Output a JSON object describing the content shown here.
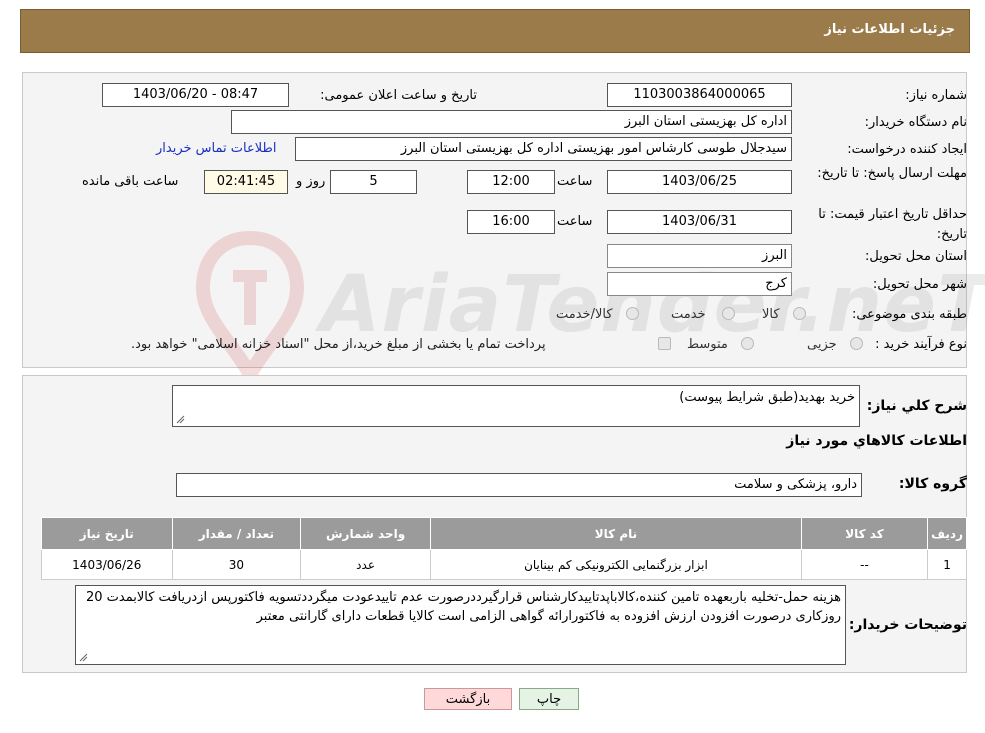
{
  "header": {
    "title": "جزئیات اطلاعات نیاز"
  },
  "details": {
    "need_number_label": "شماره نیاز:",
    "need_number": "1103003864000065",
    "announce_label": "تاریخ و ساعت اعلان عمومی:",
    "announce_value": "1403/06/20 - 08:47",
    "buyer_org_label": "نام دستگاه خریدار:",
    "buyer_org": "اداره کل بهزیستی استان البرز",
    "requester_label": "ایجاد کننده درخواست:",
    "requester": "سیدجلال طوسی کارشاس امور بهزیستی اداره کل بهزیستی استان البرز",
    "contact_link": "اطلاعات تماس خریدار",
    "deadline_label": "مهلت ارسال پاسخ: تا تاریخ:",
    "deadline_date": "1403/06/25",
    "time_label": "ساعت",
    "deadline_time": "12:00",
    "days_value": "5",
    "days_label": "روز و",
    "remaining_time": "02:41:45",
    "remaining_label": "ساعت باقی مانده",
    "validity_label": "حداقل تاریخ اعتبار قیمت: تا تاریخ:",
    "validity_date": "1403/06/31",
    "validity_time": "16:00",
    "province_label": "استان محل تحویل:",
    "province": "البرز",
    "city_label": "شهر محل تحویل:",
    "city": "کرج",
    "category_label": "طبقه بندی موضوعی:",
    "category_options": [
      "کالا",
      "خدمت",
      "کالا/خدمت"
    ],
    "process_label": "نوع فرآیند خرید :",
    "process_options": [
      "جزیی",
      "متوسط"
    ],
    "process_note": "پرداخت تمام یا بخشی از مبلغ خرید،از محل \"اسناد خزانه اسلامی\" خواهد بود."
  },
  "watermark": {
    "text": "AriaTender.neT"
  },
  "summary": {
    "desc_label": "شرح کلي نياز:",
    "desc_value": "خرید بهدید(طبق شرایط پیوست)",
    "items_title": "اطلاعات کالاهاي مورد نياز",
    "group_label": "گروه کالا:",
    "group_value": "دارو، پزشکی و سلامت",
    "table": {
      "headers": [
        "ردیف",
        "کد کالا",
        "نام کالا",
        "واحد شمارش",
        "تعداد / مقدار",
        "تاریخ نیاز"
      ],
      "rows": [
        [
          "1",
          "--",
          "ابزار بزرگنمایی الکترونیکی کم بینایان",
          "عدد",
          "30",
          "1403/06/26"
        ]
      ]
    },
    "buyer_notes_label": "توضیحات خریدار:",
    "buyer_notes": "هزینه حمل-تخلیه باربعهده تامین کننده،کالاباپدتاییدکارشناس قرارگیرددرصورت عدم تاییدعودت میگرددتسویه فاکتورپس ازدریافت کالابمدت 20 روزکاری درصورت افزودن ارزش افزوده به فاکتورارائه گواهی الزامی است کالایا قطعات دارای گارانتی معتبر"
  },
  "buttons": {
    "back": "بازگشت",
    "print": "چاپ"
  }
}
